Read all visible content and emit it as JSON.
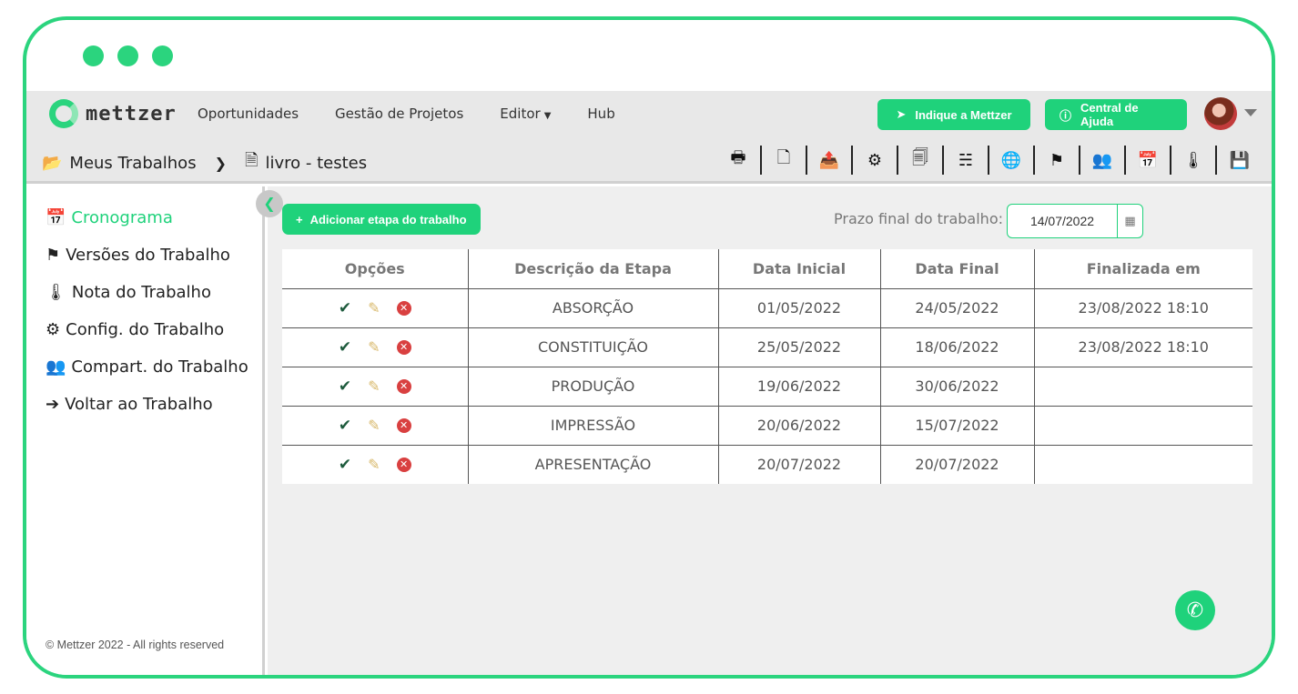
{
  "window": {
    "controls": [
      "dot",
      "dot",
      "dot"
    ]
  },
  "navbar": {
    "brand": "mettzer",
    "links": [
      "Oportunidades",
      "Gestão de Projetos",
      "Editor",
      "Hub"
    ],
    "indique_label": "Indique a Mettzer",
    "ajuda_label": "Central de Ajuda"
  },
  "breadcrumb": {
    "root": "Meus Trabalhos",
    "current": "livro - testes"
  },
  "toolbar": {
    "icons": [
      "print-icon",
      "word-icon",
      "export-icon",
      "settings-icon",
      "copy-icon",
      "binoculars-icon",
      "globe-icon",
      "flag-icon",
      "users-icon",
      "calendar-icon",
      "thermometer-icon",
      "save-icon"
    ]
  },
  "sidebar": {
    "items": [
      {
        "label": "Cronograma",
        "icon": "calendar-icon"
      },
      {
        "label": "Versões do Trabalho",
        "icon": "flag-icon"
      },
      {
        "label": "Nota do Trabalho",
        "icon": "thermometer-icon"
      },
      {
        "label": "Config. do Trabalho",
        "icon": "settings-icon"
      },
      {
        "label": "Compart. do Trabalho",
        "icon": "users-icon"
      },
      {
        "label": "Voltar ao Trabalho",
        "icon": "arrow-left-circle-icon"
      }
    ],
    "copyright": "© Mettzer 2022 - All rights reserved"
  },
  "main": {
    "add_label": "Adicionar etapa do trabalho",
    "deadline_label": "Prazo final do trabalho:",
    "deadline_value": "14/07/2022",
    "table": {
      "headers": [
        "Opções",
        "Descrição da Etapa",
        "Data Inicial",
        "Data Final",
        "Finalizada em"
      ],
      "rows": [
        {
          "descricao": "ABSORÇÃO",
          "inicio": "01/05/2022",
          "fim": "24/05/2022",
          "finalizada": "23/08/2022 18:10"
        },
        {
          "descricao": "CONSTITUIÇÃO",
          "inicio": "25/05/2022",
          "fim": "18/06/2022",
          "finalizada": "23/08/2022 18:10"
        },
        {
          "descricao": "PRODUÇÃO",
          "inicio": "19/06/2022",
          "fim": "30/06/2022",
          "finalizada": ""
        },
        {
          "descricao": "IMPRESSÃO",
          "inicio": "20/06/2022",
          "fim": "15/07/2022",
          "finalizada": ""
        },
        {
          "descricao": "APRESENTAÇÃO",
          "inicio": "20/07/2022",
          "fim": "20/07/2022",
          "finalizada": ""
        }
      ]
    }
  },
  "colors": {
    "accent": "#1fd27b",
    "frame": "#2bd47e",
    "danger": "#d94040",
    "edit": "#d8b86a",
    "check": "#1e5b3d"
  }
}
